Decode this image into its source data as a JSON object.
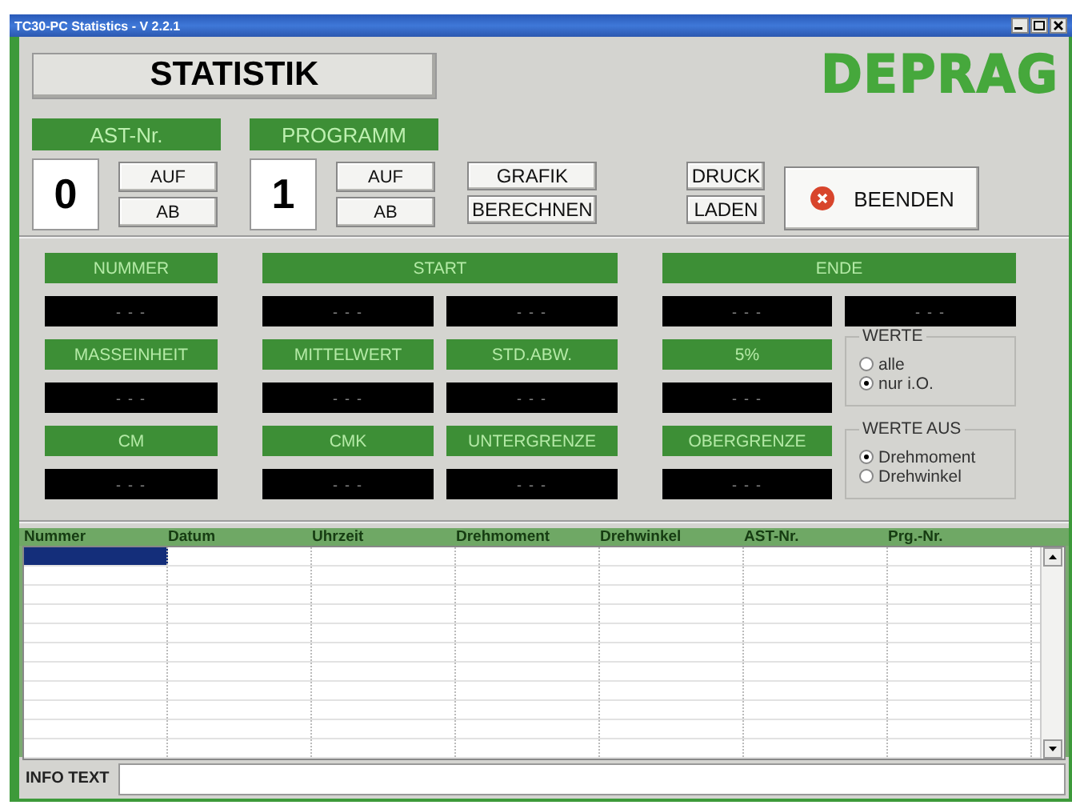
{
  "window": {
    "title": "TC30-PC Statistics - V 2.2.1"
  },
  "header": {
    "title": "STATISTIK",
    "logo": "DEPRAG"
  },
  "counters": [
    {
      "label": "AST-Nr.",
      "value": "0",
      "up": "AUF",
      "down": "AB"
    },
    {
      "label": "PROGRAMM",
      "value": "1",
      "up": "AUF",
      "down": "AB"
    }
  ],
  "action_groups": [
    {
      "buttons": [
        "GRAFIK",
        "BERECHNEN"
      ]
    },
    {
      "buttons": [
        "DRUCK",
        "LADEN"
      ]
    }
  ],
  "exit_button": {
    "label": "BEENDEN"
  },
  "field_rows": [
    [
      {
        "label": "NUMMER",
        "values": [
          "- - -"
        ]
      },
      {
        "label": "START",
        "values": [
          "- - -",
          "- - -"
        ]
      },
      {
        "label": "ENDE",
        "values": [
          "- - -",
          "- - -"
        ]
      }
    ],
    [
      {
        "label": "MASSEINHEIT",
        "values": [
          "- - -"
        ]
      },
      {
        "label": "MITTELWERT",
        "values": [
          "- - -"
        ]
      },
      {
        "label": "STD.ABW.",
        "values": [
          "- - -"
        ]
      },
      {
        "label": "5%",
        "values": [
          "- - -"
        ]
      }
    ],
    [
      {
        "label": "CM",
        "values": [
          "- - -"
        ]
      },
      {
        "label": "CMK",
        "values": [
          "- - -"
        ]
      },
      {
        "label": "UNTERGRENZE",
        "values": [
          "- - -"
        ]
      },
      {
        "label": "OBERGRENZE",
        "values": [
          "- - -"
        ]
      }
    ]
  ],
  "option_groups": [
    {
      "title": "WERTE",
      "options": [
        {
          "label": "alle",
          "selected": false
        },
        {
          "label": "nur i.O.",
          "selected": true
        }
      ]
    },
    {
      "title": "WERTE AUS",
      "options": [
        {
          "label": "Drehmoment",
          "selected": true
        },
        {
          "label": "Drehwinkel",
          "selected": false
        }
      ]
    }
  ],
  "table": {
    "columns": [
      "Nummer",
      "Datum",
      "Uhrzeit",
      "Drehmoment",
      "Drehwinkel",
      "AST-Nr.",
      "Prg.-Nr."
    ],
    "rows": [
      {
        "selected": true
      },
      {
        "selected": false
      },
      {
        "selected": false
      },
      {
        "selected": false
      },
      {
        "selected": false
      },
      {
        "selected": false
      },
      {
        "selected": false
      },
      {
        "selected": false
      },
      {
        "selected": false
      },
      {
        "selected": false
      },
      {
        "selected": false
      }
    ]
  },
  "info_bar": {
    "label": "INFO TEXT"
  }
}
